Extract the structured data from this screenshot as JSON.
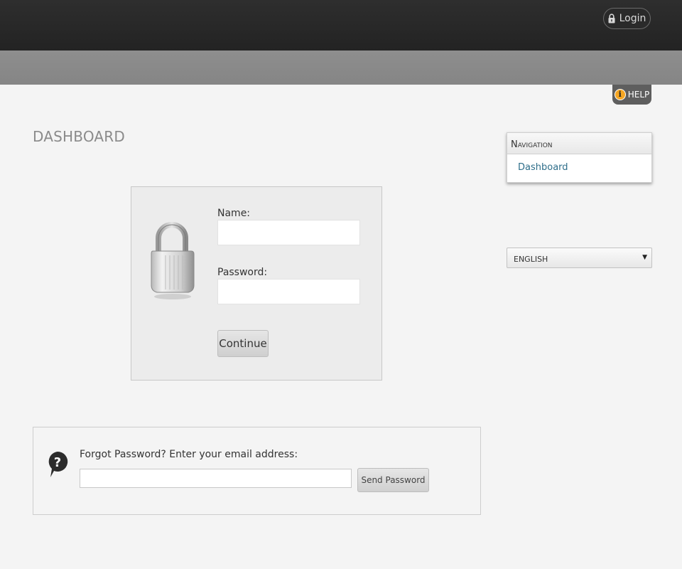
{
  "header": {
    "login_label": "Login",
    "help_label": "HELP"
  },
  "page": {
    "title": "DASHBOARD"
  },
  "login_form": {
    "name_label": "Name:",
    "name_value": "",
    "password_label": "Password:",
    "password_value": "",
    "continue_label": "Continue"
  },
  "forgot": {
    "label": "Forgot Password? Enter your email address:",
    "email_value": "",
    "send_label": "Send Password"
  },
  "navigation": {
    "title": "Navigation",
    "items": [
      {
        "label": "Dashboard"
      }
    ]
  },
  "language": {
    "selected": "ENGLISH"
  },
  "icons": {
    "login": "lock-icon",
    "help": "info-icon",
    "login_box": "padlock-icon",
    "forgot": "question-bubble-icon"
  },
  "colors": {
    "topbar": "#262626",
    "subbar": "#8a8a8a",
    "background": "#f4f4f4",
    "link": "#2e6e8a",
    "help_accent": "#f5a623"
  }
}
